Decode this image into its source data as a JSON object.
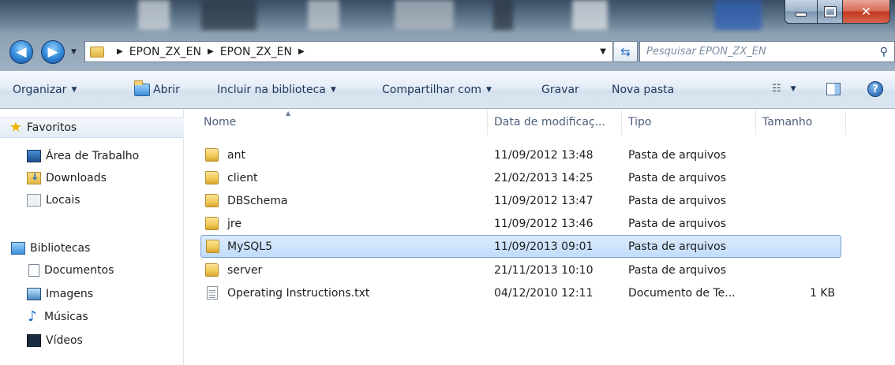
{
  "address": {
    "crumbs": [
      "EPON_ZX_EN",
      "EPON_ZX_EN"
    ],
    "search_placeholder": "Pesquisar EPON_ZX_EN"
  },
  "toolbar": {
    "organize": "Organizar",
    "open": "Abrir",
    "include_library": "Incluir na biblioteca",
    "share": "Compartilhar com",
    "burn": "Gravar",
    "new_folder": "Nova pasta"
  },
  "nav": {
    "favorites": "Favoritos",
    "desktop": "Área de Trabalho",
    "downloads": "Downloads",
    "places": "Locais",
    "libraries": "Bibliotecas",
    "documents": "Documentos",
    "images": "Imagens",
    "music": "Músicas",
    "videos": "Vídeos"
  },
  "columns": {
    "name": "Nome",
    "date": "Data de modificaç...",
    "type": "Tipo",
    "size": "Tamanho"
  },
  "files": [
    {
      "name": "ant",
      "date": "11/09/2012 13:48",
      "type": "Pasta de arquivos",
      "size": "",
      "icon": "folder-icon"
    },
    {
      "name": "client",
      "date": "21/02/2013 14:25",
      "type": "Pasta de arquivos",
      "size": "",
      "icon": "folder-icon"
    },
    {
      "name": "DBSchema",
      "date": "11/09/2012 13:47",
      "type": "Pasta de arquivos",
      "size": "",
      "icon": "folder-icon"
    },
    {
      "name": "jre",
      "date": "11/09/2012 13:46",
      "type": "Pasta de arquivos",
      "size": "",
      "icon": "folder-icon"
    },
    {
      "name": "MySQL5",
      "date": "11/09/2013 09:01",
      "type": "Pasta de arquivos",
      "size": "",
      "icon": "folder-icon",
      "selected": true
    },
    {
      "name": "server",
      "date": "21/11/2013 10:10",
      "type": "Pasta de arquivos",
      "size": "",
      "icon": "folder-icon"
    },
    {
      "name": "Operating Instructions.txt",
      "date": "04/12/2010 12:11",
      "type": "Documento de Te...",
      "size": "1 KB",
      "icon": "text-file-icon"
    }
  ],
  "colors": {
    "selection": "#cce1fb",
    "command_text": "#1e395b",
    "close_button": "#c4381f"
  }
}
